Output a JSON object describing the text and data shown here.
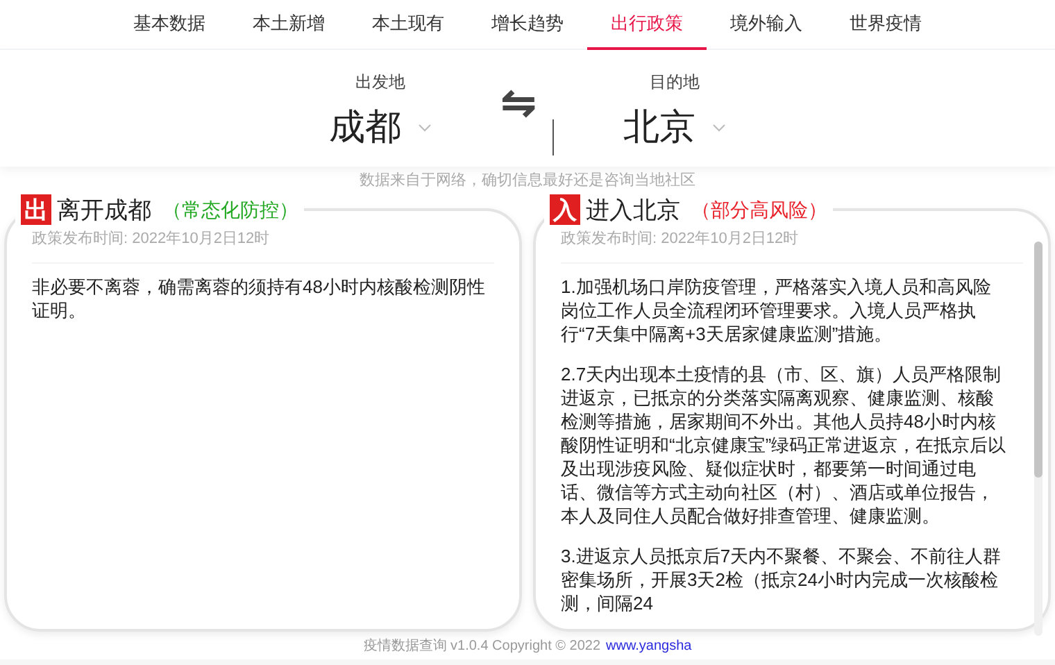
{
  "nav": [
    {
      "label": "基本数据",
      "selected": false
    },
    {
      "label": "本土新增",
      "selected": false
    },
    {
      "label": "本土现有",
      "selected": false
    },
    {
      "label": "增长趋势",
      "selected": false
    },
    {
      "label": "出行政策",
      "selected": true
    },
    {
      "label": "境外输入",
      "selected": false
    },
    {
      "label": "世界疫情",
      "selected": false
    }
  ],
  "route": {
    "from": {
      "label": "出发地",
      "city": "成都"
    },
    "swap": "⇋",
    "to": {
      "label": "目的地",
      "city": "北京"
    }
  },
  "notice": "数据来自于网络，确切信息最好还是咨询当地社区",
  "panels": [
    {
      "badge": "出",
      "title": "离开成都",
      "risk": "（常态化防控）",
      "color": "#22a822",
      "time": "政策发布时间: 2022年10月2日12时",
      "paragraphs": [
        "非必要不离蓉，确需离蓉的须持有48小时内核酸检测阴性证明。"
      ],
      "scrollable": false
    },
    {
      "badge": "入",
      "title": "进入北京",
      "risk": "（部分高风险）",
      "color": "#e8202a",
      "time": "政策发布时间: 2022年10月2日12时",
      "paragraphs": [
        "1.加强机场口岸防疫管理，严格落实入境人员和高风险岗位工作人员全流程闭环管理要求。入境人员严格执行“7天集中隔离+3天居家健康监测”措施。",
        "2.7天内出现本土疫情的县（市、区、旗）人员严格限制进返京，已抵京的分类落实隔离观察、健康监测、核酸检测等措施，居家期间不外出。其他人员持48小时内核酸阴性证明和“北京健康宝”绿码正常进返京，在抵京后以及出现涉疫风险、疑似症状时，都要第一时间通过电话、微信等方式主动向社区（村）、酒店或单位报告，本人及同住人员配合做好排查管理、健康监测。",
        "3.进返京人员抵京后7天内不聚餐、不聚会、不前往人群密集场所，开展3天2检（抵京24小时内完成一次核酸检测，间隔24"
      ],
      "scrollable": true
    }
  ],
  "footer": {
    "text": "疫情数据查询 v1.0.4 Copyright © 2022",
    "link": "www.yangsha"
  }
}
